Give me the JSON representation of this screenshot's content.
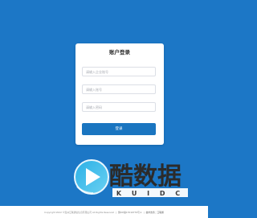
{
  "login": {
    "title": "账户登录",
    "company_placeholder": "请输入企业账号",
    "account_placeholder": "请输入账号",
    "password_placeholder": "请输入密码",
    "submit_label": "登录"
  },
  "watermark": {
    "brand": "酷数据",
    "letters": "K U I D C"
  },
  "footer": {
    "copyright": "Copyright 2022 ©温州江联通信信息有限公司 All Rights Reserved",
    "icp": "浙ICP备17010770号-1",
    "support": "技术支持：江联通"
  },
  "colors": {
    "background": "#1c77c6",
    "card": "#ffffff",
    "button": "#1a75c0",
    "footer": "#ffffff",
    "logo_gradient_start": "#2bb0e6",
    "logo_gradient_end": "#6ad1f2"
  }
}
